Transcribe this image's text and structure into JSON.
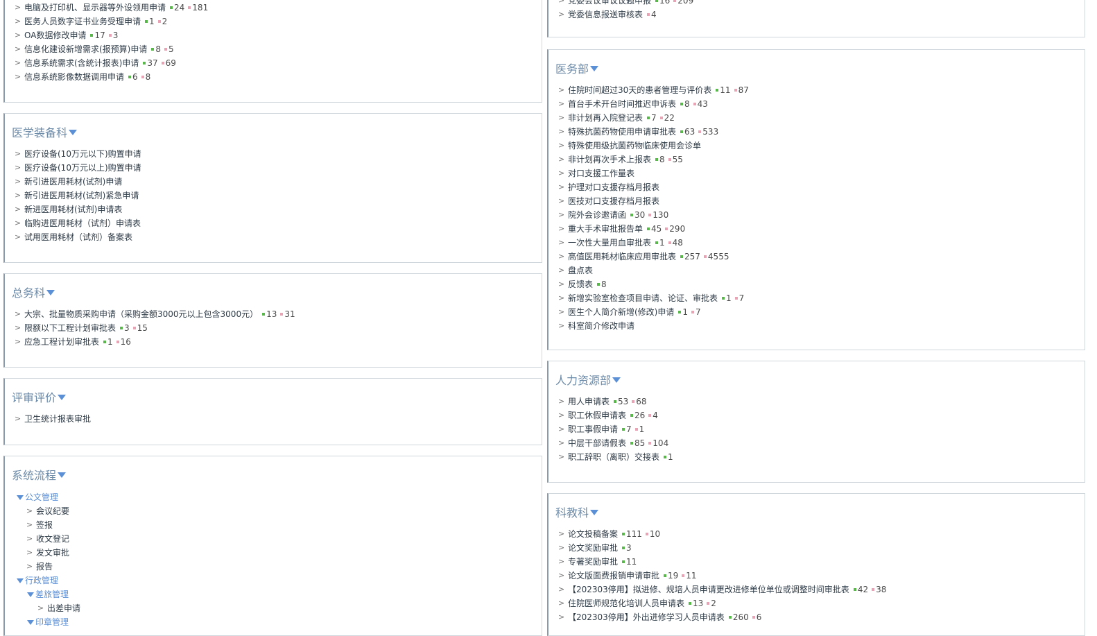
{
  "left": {
    "top_partial": {
      "items": [
        {
          "label": "电脑及打印机、显示器等外设领用申请",
          "green": "24",
          "red": "181"
        },
        {
          "label": "医务人员数字证书业务受理申请",
          "green": "1",
          "red": "2"
        },
        {
          "label": "OA数据修改申请",
          "green": "17",
          "red": "3"
        },
        {
          "label": "信息化建设新增需求(报预算)申请",
          "green": "8",
          "red": "5"
        },
        {
          "label": "信息系统需求(含统计报表)申请",
          "green": "37",
          "red": "69"
        },
        {
          "label": "信息系统影像数据调用申请",
          "green": "6",
          "red": "8"
        }
      ]
    },
    "equip": {
      "title": "医学装备科",
      "items": [
        {
          "label": "医疗设备(10万元以下)购置申请"
        },
        {
          "label": "医疗设备(10万元以上)购置申请"
        },
        {
          "label": "新引进医用耗材(试剂)申请"
        },
        {
          "label": "新引进医用耗材(试剂)紧急申请"
        },
        {
          "label": "新进医用耗材(试剂)申请表"
        },
        {
          "label": "临购进医用耗材（试剂）申请表"
        },
        {
          "label": "试用医用耗材（试剂）备案表"
        }
      ]
    },
    "general": {
      "title": "总务科",
      "items": [
        {
          "label": "大宗、批量物质采购申请（采购金额3000元以上包含3000元）",
          "green": "13",
          "red": "31"
        },
        {
          "label": "限额以下工程计划审批表",
          "green": "3",
          "red": "15"
        },
        {
          "label": "应急工程计划审批表",
          "green": "1",
          "red": "16"
        }
      ]
    },
    "review": {
      "title": "评审评价",
      "items": [
        {
          "label": "卫生统计报表审批"
        }
      ]
    },
    "system": {
      "title": "系统流程",
      "tree": {
        "doc_mgmt": "公文管理",
        "doc_items": [
          "会议纪要",
          "签报",
          "收文登记",
          "发文审批",
          "报告"
        ],
        "admin_mgmt": "行政管理",
        "travel_mgmt": "差旅管理",
        "travel_item": "出差申请",
        "seal_mgmt": "印章管理"
      }
    }
  },
  "right": {
    "top_partial": {
      "items": [
        {
          "label": "党委会议审议议题申报",
          "green": "16",
          "red": "209"
        },
        {
          "label": "党委信息报送审核表",
          "red": "4"
        }
      ]
    },
    "medical": {
      "title": "医务部",
      "items": [
        {
          "label": "住院时间超过30天的患者管理与评价表",
          "green": "11",
          "red": "87"
        },
        {
          "label": "首台手术开台时间推迟申诉表",
          "green": "8",
          "red": "43"
        },
        {
          "label": "非计划再入院登记表",
          "green": "7",
          "red": "22"
        },
        {
          "label": "特殊抗菌药物使用申请审批表",
          "green": "63",
          "red": "533"
        },
        {
          "label": "特殊使用级抗菌药物临床使用会诊单"
        },
        {
          "label": "非计划再次手术上报表",
          "green": "8",
          "red": "55"
        },
        {
          "label": "对口支援工作量表"
        },
        {
          "label": "护理对口支援存档月报表"
        },
        {
          "label": "医技对口支援存档月报表"
        },
        {
          "label": "院外会诊邀请函",
          "green": "30",
          "red": "130"
        },
        {
          "label": "重大手术审批报告单",
          "green": "45",
          "red": "290"
        },
        {
          "label": "一次性大量用血审批表",
          "green": "1",
          "red": "48"
        },
        {
          "label": "高值医用耗材临床应用审批表",
          "green": "257",
          "red": "4555"
        },
        {
          "label": "盘点表"
        },
        {
          "label": "反馈表",
          "green": "8"
        },
        {
          "label": "新增实验室检查项目申请、论证、审批表",
          "green": "1",
          "red": "7"
        },
        {
          "label": "医生个人简介新增(修改)申请",
          "green": "1",
          "red": "7"
        },
        {
          "label": "科室简介修改申请"
        }
      ]
    },
    "hr": {
      "title": "人力资源部",
      "items": [
        {
          "label": "用人申请表",
          "green": "53",
          "red": "68"
        },
        {
          "label": "职工休假申请表",
          "green": "26",
          "red": "4"
        },
        {
          "label": "职工事假申请",
          "green": "7",
          "red": "1"
        },
        {
          "label": "中层干部请假表",
          "green": "85",
          "red": "104"
        },
        {
          "label": "职工辞职（离职）交接表",
          "green": "1"
        }
      ]
    },
    "science": {
      "title": "科教科",
      "items": [
        {
          "label": "论文投稿备案",
          "green": "111",
          "red": "10"
        },
        {
          "label": "论文奖励审批",
          "green": "3"
        },
        {
          "label": "专著奖励审批",
          "green": "11"
        },
        {
          "label": "论文版面费报销申请审批",
          "green": "19",
          "red": "11"
        },
        {
          "label": "【202303停用】拟进修、规培人员申请更改进修单位单位或调整时间审批表",
          "green": "42",
          "red": "38"
        },
        {
          "label": "住院医师规范化培训人员申请表",
          "green": "13",
          "red": "2"
        },
        {
          "label": "【202303停用】外出进修学习人员申请表",
          "green": "260",
          "red": "6"
        }
      ]
    }
  },
  "icons": {
    "arrow": "chevron-right-icon",
    "collapse": "collapse-triangle-icon",
    "green": "#58b84a",
    "red": "#e8a3b5"
  }
}
